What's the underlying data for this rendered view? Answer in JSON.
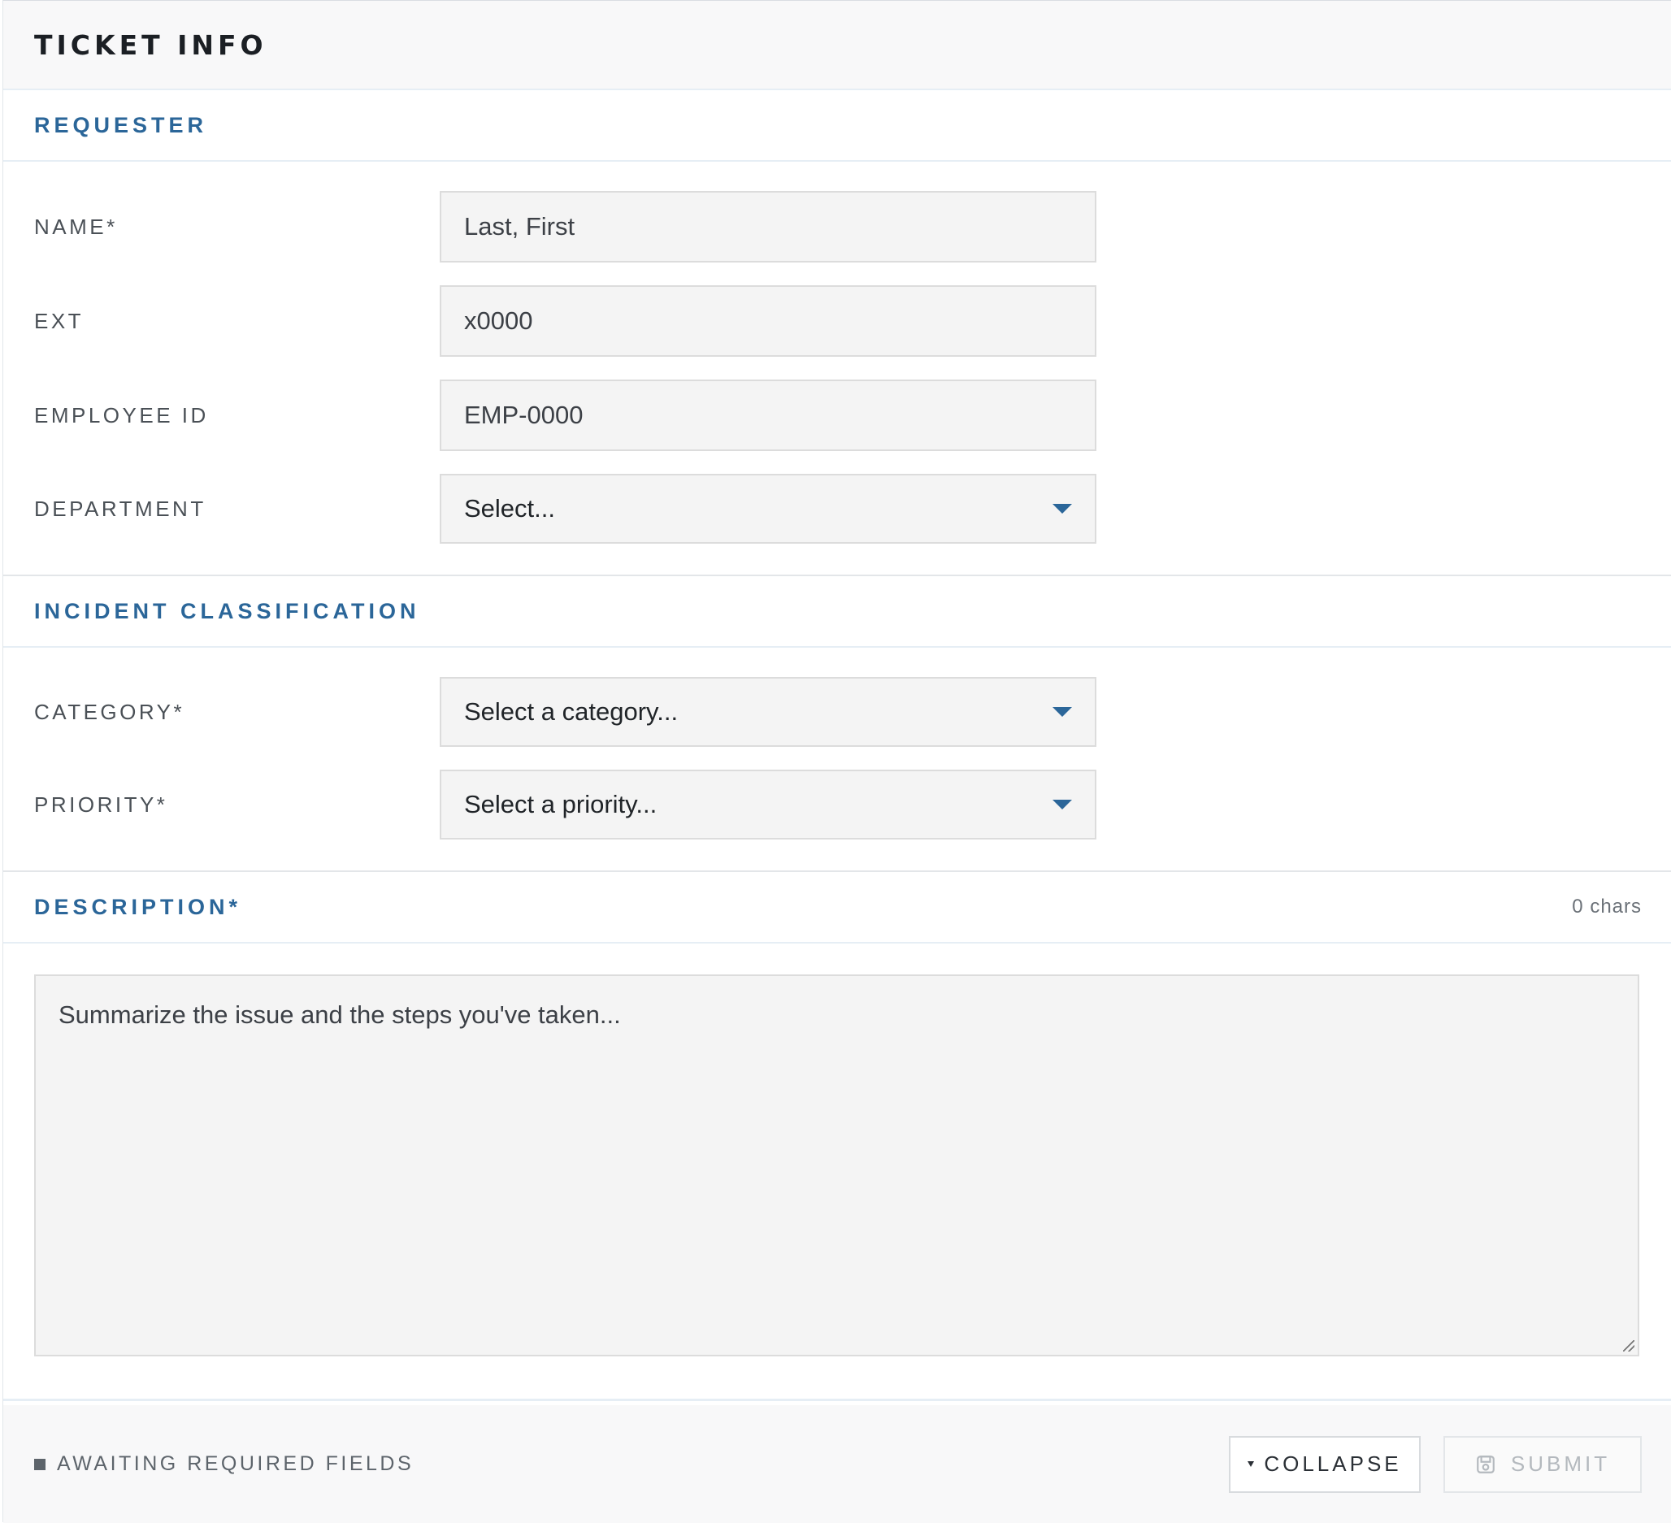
{
  "header": {
    "title": "TICKET INFO"
  },
  "requester": {
    "title": "REQUESTER",
    "name": {
      "label": "NAME*",
      "placeholder": "Last, First"
    },
    "ext": {
      "label": "EXT",
      "placeholder": "x0000"
    },
    "employee_id": {
      "label": "EMPLOYEE ID",
      "placeholder": "EMP-0000"
    },
    "department": {
      "label": "DEPARTMENT",
      "selected": "Select..."
    }
  },
  "incident": {
    "title": "INCIDENT CLASSIFICATION",
    "category": {
      "label": "CATEGORY*",
      "selected": "Select a category..."
    },
    "priority": {
      "label": "PRIORITY*",
      "selected": "Select a priority..."
    }
  },
  "description": {
    "title": "DESCRIPTION*",
    "char_count": "0 chars",
    "placeholder": "Summarize the issue and the steps you've taken..."
  },
  "footer": {
    "status": "AWAITING REQUIRED FIELDS",
    "collapse_label": "COLLAPSE",
    "submit_label": "SUBMIT"
  },
  "colors": {
    "accent": "#2b6699",
    "field_bg": "#f4f4f4",
    "muted": "#5d646b"
  },
  "icons": {
    "dropdown": "caret-down-icon",
    "collapse": "triangle-down-icon",
    "submit": "save-icon",
    "status": "status-square-icon"
  }
}
